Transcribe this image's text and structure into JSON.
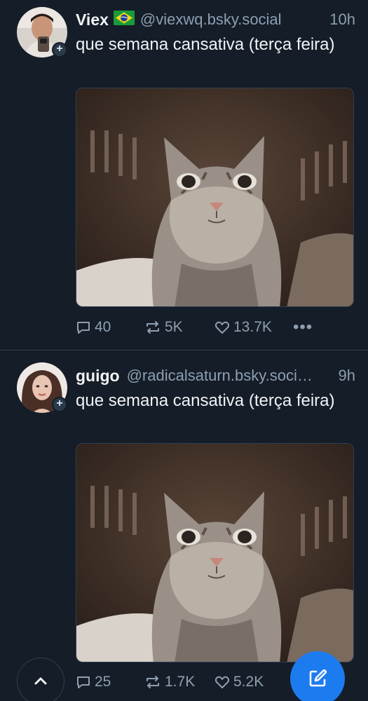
{
  "posts": [
    {
      "display_name": "Viex",
      "flag_icon": "brazil-flag-icon",
      "handle": "@viexwq.bsky.social",
      "time": "10h",
      "text": "que semana cansativa (terça feira)",
      "image_description": "cat-selfie",
      "replies": "40",
      "reposts": "5K",
      "likes": "13.7K",
      "more_label": "•••"
    },
    {
      "display_name": "guigo",
      "handle": "@radicalsaturn.bsky.soci…",
      "time": "9h",
      "text": "que semana cansativa (terça feira)",
      "image_description": "cat-selfie",
      "replies": "25",
      "reposts": "1.7K",
      "likes": "5.2K"
    }
  ],
  "colors": {
    "background": "#151d28",
    "text_primary": "#f1f3f5",
    "text_secondary": "#8d9fb1",
    "divider": "#2e4052",
    "compose_button": "#1d7bf0"
  },
  "icons": {
    "reply": "reply-icon",
    "repost": "repost-icon",
    "like": "heart-icon",
    "more": "more-options-icon",
    "scroll_top": "chevron-up-icon",
    "compose": "compose-icon",
    "follow": "plus-icon"
  }
}
